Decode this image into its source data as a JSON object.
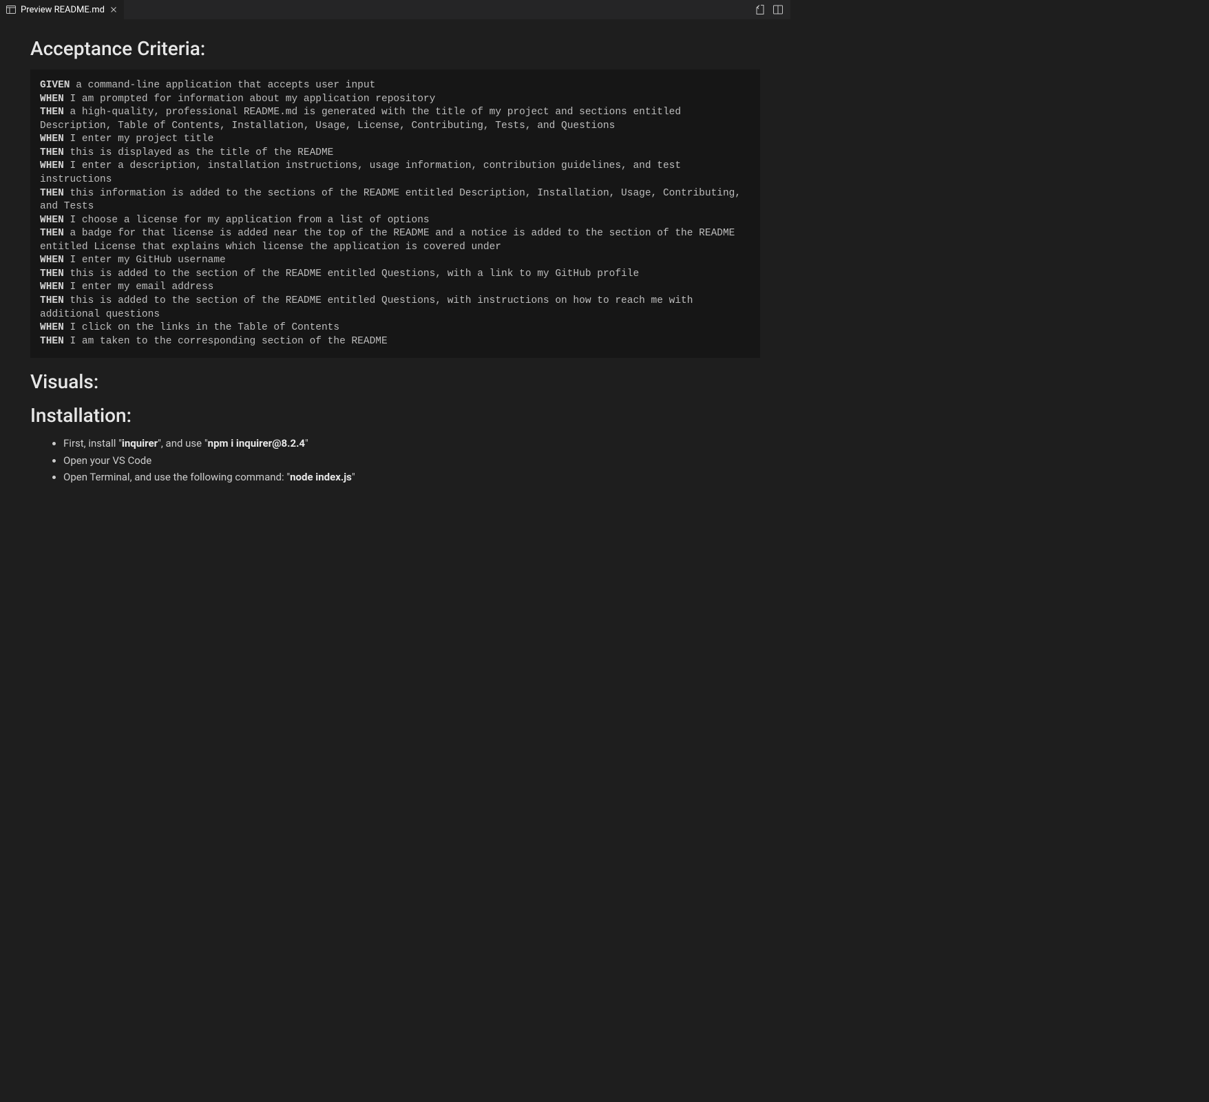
{
  "tab": {
    "title": "Preview README.md"
  },
  "headings": {
    "acceptance_criteria": "Acceptance Criteria:",
    "visuals": "Visuals:",
    "installation": "Installation:"
  },
  "criteria": [
    {
      "kw": "GIVEN",
      "text": " a command-line application that accepts user input"
    },
    {
      "kw": "WHEN",
      "text": " I am prompted for information about my application repository"
    },
    {
      "kw": "THEN",
      "text": " a high-quality, professional README.md is generated with the title of my project and sections entitled Description, Table of Contents, Installation, Usage, License, Contributing, Tests, and Questions"
    },
    {
      "kw": "WHEN",
      "text": " I enter my project title"
    },
    {
      "kw": "THEN",
      "text": " this is displayed as the title of the README"
    },
    {
      "kw": "WHEN",
      "text": " I enter a description, installation instructions, usage information, contribution guidelines, and test instructions"
    },
    {
      "kw": "THEN",
      "text": " this information is added to the sections of the README entitled Description, Installation, Usage, Contributing, and Tests"
    },
    {
      "kw": "WHEN",
      "text": " I choose a license for my application from a list of options"
    },
    {
      "kw": "THEN",
      "text": " a badge for that license is added near the top of the README and a notice is added to the section of the README entitled License that explains which license the application is covered under"
    },
    {
      "kw": "WHEN",
      "text": " I enter my GitHub username"
    },
    {
      "kw": "THEN",
      "text": " this is added to the section of the README entitled Questions, with a link to my GitHub profile"
    },
    {
      "kw": "WHEN",
      "text": " I enter my email address"
    },
    {
      "kw": "THEN",
      "text": " this is added to the section of the README entitled Questions, with instructions on how to reach me with additional questions"
    },
    {
      "kw": "WHEN",
      "text": " I click on the links in the Table of Contents"
    },
    {
      "kw": "THEN",
      "text": " I am taken to the corresponding section of the README"
    }
  ],
  "installation_steps": [
    {
      "parts": [
        {
          "t": "First, install \""
        },
        {
          "b": "inquirer"
        },
        {
          "t": "\", and use \""
        },
        {
          "b": "npm i inquirer@8.2.4"
        },
        {
          "t": "\""
        }
      ]
    },
    {
      "parts": [
        {
          "t": "Open your VS Code"
        }
      ]
    },
    {
      "parts": [
        {
          "t": "Open Terminal, and use the following command: \""
        },
        {
          "b": "node index.js"
        },
        {
          "t": "\""
        }
      ]
    }
  ]
}
